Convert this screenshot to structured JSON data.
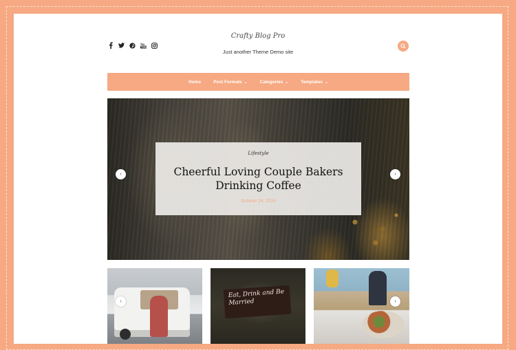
{
  "site": {
    "logo_text": "Crafty Blog Pro",
    "tagline": "Just another Theme Demo site"
  },
  "social_icons": [
    "facebook-icon",
    "twitter-icon",
    "pinterest-icon",
    "youtube-icon",
    "instagram-icon"
  ],
  "nav": {
    "items": [
      {
        "label": "Home",
        "has_dropdown": false
      },
      {
        "label": "Post Formats",
        "has_dropdown": true
      },
      {
        "label": "Categories",
        "has_dropdown": true
      },
      {
        "label": "Templates",
        "has_dropdown": true
      }
    ]
  },
  "slider": {
    "category": "Lifestyle",
    "title": "Cheerful Loving Couple Bakers Drinking Coffee",
    "date": "October 24, 2020",
    "sign_text": "Eat, Drink and Be Married"
  },
  "thumbnails": {
    "sign_text": "Eat, Drink and Be Married"
  },
  "colors": {
    "accent": "#f6a983",
    "background": "#ffffff"
  }
}
